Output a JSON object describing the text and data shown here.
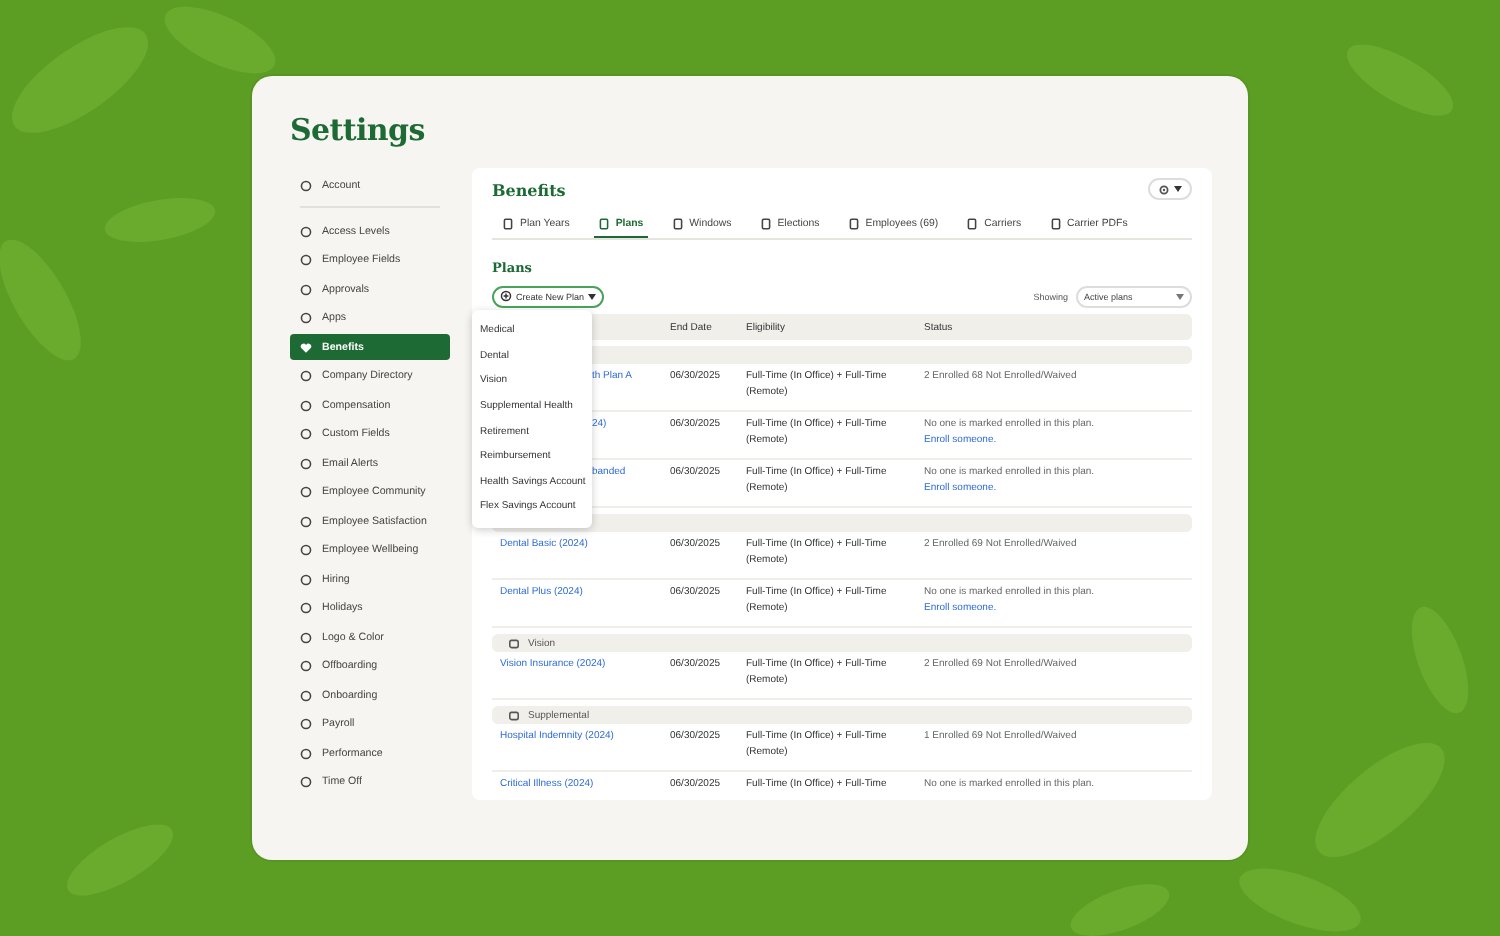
{
  "title": "Settings",
  "sidebar": {
    "items": [
      {
        "label": "Account",
        "selected": false,
        "divider_after": true
      },
      {
        "label": "Access Levels",
        "selected": false
      },
      {
        "label": "Employee Fields",
        "selected": false
      },
      {
        "label": "Approvals",
        "selected": false
      },
      {
        "label": "Apps",
        "selected": false
      },
      {
        "label": "Benefits",
        "selected": true
      },
      {
        "label": "Company Directory",
        "selected": false
      },
      {
        "label": "Compensation",
        "selected": false
      },
      {
        "label": "Custom Fields",
        "selected": false
      },
      {
        "label": "Email Alerts",
        "selected": false
      },
      {
        "label": "Employee Community",
        "selected": false
      },
      {
        "label": "Employee Satisfaction",
        "selected": false
      },
      {
        "label": "Employee Wellbeing",
        "selected": false
      },
      {
        "label": "Hiring",
        "selected": false
      },
      {
        "label": "Holidays",
        "selected": false
      },
      {
        "label": "Logo & Color",
        "selected": false
      },
      {
        "label": "Offboarding",
        "selected": false
      },
      {
        "label": "Onboarding",
        "selected": false
      },
      {
        "label": "Payroll",
        "selected": false
      },
      {
        "label": "Performance",
        "selected": false
      },
      {
        "label": "Time Off",
        "selected": false
      }
    ]
  },
  "panel": {
    "title": "Benefits",
    "tabs": [
      {
        "label": "Plan Years",
        "selected": false
      },
      {
        "label": "Plans",
        "selected": true
      },
      {
        "label": "Windows",
        "selected": false
      },
      {
        "label": "Elections",
        "selected": false
      },
      {
        "label": "Employees (69)",
        "selected": false
      },
      {
        "label": "Carriers",
        "selected": false
      },
      {
        "label": "Carrier PDFs",
        "selected": false
      }
    ],
    "section_title": "Plans",
    "create_button": "Create New Plan",
    "showing_label": "Showing",
    "filter": {
      "value": "Active plans"
    },
    "table": {
      "columns": [
        "End Date",
        "Eligibility",
        "Status"
      ],
      "groups": [
        {
          "rows": [
            {
              "kind": "partial",
              "name": "th Plan A",
              "end_date": "06/30/2025",
              "eligibility": [
                "Full-Time (In Office) + Full-Time",
                "(Remote)"
              ],
              "status": "2 Enrolled 68 Not Enrolled/Waived"
            },
            {
              "kind": "partial",
              "name": "24)",
              "end_date": "06/30/2025",
              "eligibility": [
                "Full-Time (In Office) + Full-Time",
                "(Remote)"
              ],
              "status": "No one is marked enrolled in this plan.",
              "link": "Enroll someone."
            },
            {
              "kind": "partial",
              "name": "banded",
              "end_date": "06/30/2025",
              "eligibility": [
                "Full-Time (In Office) + Full-Time",
                "(Remote)"
              ],
              "status": "No one is marked enrolled in this plan.",
              "link": "Enroll someone."
            }
          ]
        },
        {
          "rows": [
            {
              "kind": "full",
              "name": "Dental Basic (2024)",
              "end_date": "06/30/2025",
              "eligibility": [
                "Full-Time (In Office) + Full-Time",
                "(Remote)"
              ],
              "status": "2 Enrolled 69 Not Enrolled/Waived"
            },
            {
              "kind": "full",
              "name": "Dental Plus (2024)",
              "end_date": "06/30/2025",
              "eligibility": [
                "Full-Time (In Office) + Full-Time",
                "(Remote)"
              ],
              "status": "No one is marked enrolled in this plan.",
              "link": "Enroll someone."
            }
          ]
        },
        {
          "label": "Vision",
          "rows": [
            {
              "kind": "full",
              "name": "Vision Insurance (2024)",
              "end_date": "06/30/2025",
              "eligibility": [
                "Full-Time (In Office) + Full-Time",
                "(Remote)"
              ],
              "status": "2 Enrolled 69 Not Enrolled/Waived"
            }
          ]
        },
        {
          "label": "Supplemental",
          "rows": [
            {
              "kind": "full",
              "name": "Hospital Indemnity (2024)",
              "end_date": "06/30/2025",
              "eligibility": [
                "Full-Time (In Office) + Full-Time",
                "(Remote)"
              ],
              "status": "1 Enrolled 69 Not Enrolled/Waived"
            },
            {
              "kind": "full",
              "name": "Critical Illness (2024)",
              "end_date": "06/30/2025",
              "eligibility": [
                "Full-Time (In Office) + Full-Time"
              ],
              "status": "No one is marked enrolled in this plan."
            }
          ]
        }
      ]
    },
    "menu": {
      "items": [
        "Medical",
        "Dental",
        "Vision",
        "Supplemental Health",
        "Retirement",
        "Reimbursement",
        "Health Savings Account",
        "Flex Savings Account"
      ]
    }
  }
}
